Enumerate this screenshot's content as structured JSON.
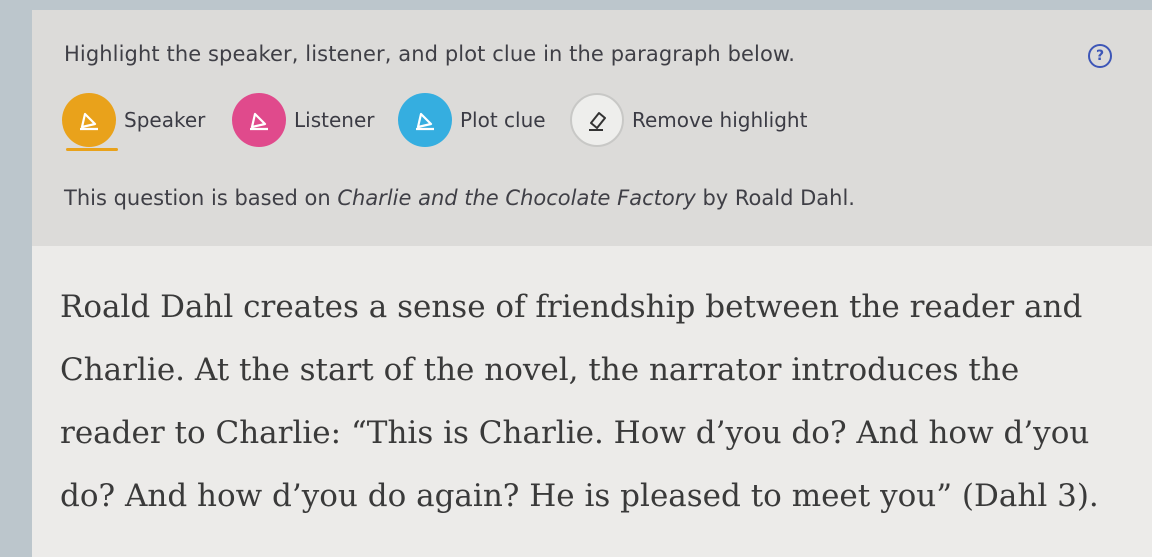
{
  "instruction": "Highlight the speaker, listener, and plot clue in the paragraph below.",
  "help_label": "?",
  "tools": {
    "speaker": "Speaker",
    "listener": "Listener",
    "plot_clue": "Plot clue",
    "remove": "Remove highlight"
  },
  "source": {
    "prefix": "This question is based on ",
    "title": "Charlie and the Chocolate Factory",
    "suffix": " by Roald Dahl."
  },
  "passage": "Roald Dahl creates a sense of friendship between the reader and Charlie. At the start of the novel, the narrator introduces the reader to Charlie: “This is Charlie. How d’you do? And how d’you do? And how d’you do again? He is pleased to meet you” (Dahl 3).",
  "colors": {
    "speaker": "#e9a21b",
    "listener": "#e04a8c",
    "plot_clue": "#35aee0",
    "help": "#3d56b7"
  }
}
